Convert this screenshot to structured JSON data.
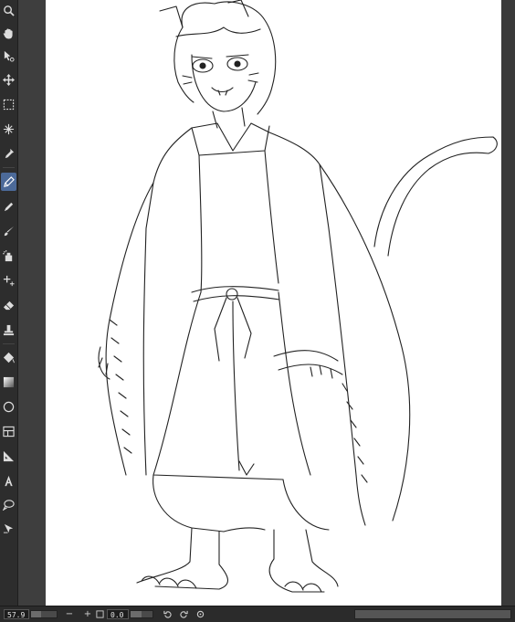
{
  "tools": [
    {
      "name": "zoom-icon",
      "active": false
    },
    {
      "name": "hand-icon",
      "active": false
    },
    {
      "name": "object-icon",
      "active": false
    },
    {
      "name": "move-icon",
      "active": false
    },
    {
      "name": "selection-icon",
      "active": false
    },
    {
      "name": "auto-select-icon",
      "active": false
    },
    {
      "name": "eyedropper-icon",
      "active": false
    },
    {
      "name": "pen-icon",
      "active": true
    },
    {
      "name": "pencil-icon",
      "active": false
    },
    {
      "name": "brush-icon",
      "active": false
    },
    {
      "name": "airbrush-icon",
      "active": false
    },
    {
      "name": "decoration-icon",
      "active": false
    },
    {
      "name": "eraser-icon",
      "active": false
    },
    {
      "name": "blend-icon",
      "active": false
    },
    {
      "name": "fill-icon",
      "active": false
    },
    {
      "name": "gradient-icon",
      "active": false
    },
    {
      "name": "figure-icon",
      "active": false
    },
    {
      "name": "frame-border-icon",
      "active": false
    },
    {
      "name": "ruler-icon",
      "active": false
    },
    {
      "name": "text-icon",
      "active": false
    },
    {
      "name": "balloon-icon",
      "active": false
    },
    {
      "name": "correct-line-icon",
      "active": false
    }
  ],
  "statusbar": {
    "zoom_value": "57.9",
    "zoom_out_label": "−",
    "zoom_in_label": "+",
    "rotation_value": "0.0"
  },
  "colors": {
    "accent": "#4c6a99",
    "toolbar_bg": "#2d2d2d",
    "canvas_bg": "#ffffff",
    "workspace_bg": "#3e3e3e"
  }
}
